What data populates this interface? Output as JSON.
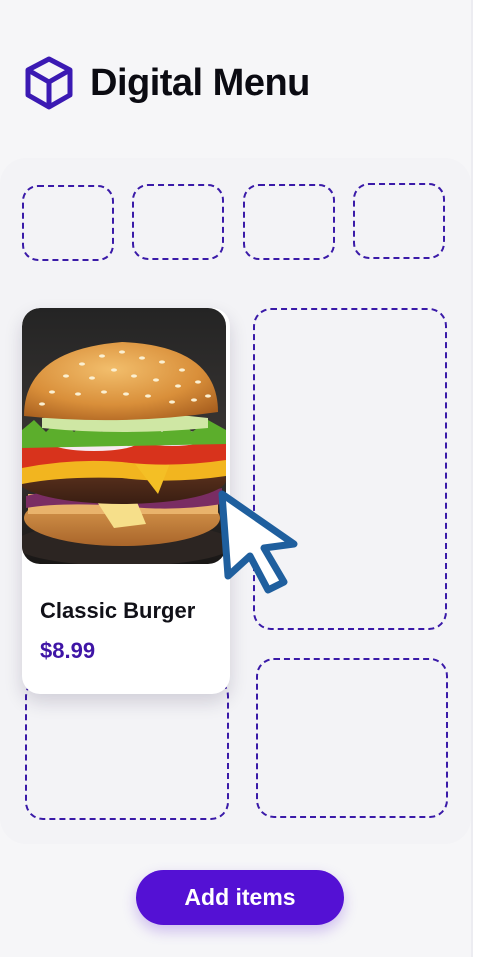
{
  "app": {
    "title": "Digital Menu",
    "logo_icon": "cube-icon",
    "brand_color": "#4b1cc0"
  },
  "menu_board": {
    "empty_slot_count": 7,
    "items": [
      {
        "name": "Classic Burger",
        "price": "$8.99",
        "image": "burger-photo"
      }
    ]
  },
  "cursor": {
    "icon": "pointer-arrow-icon"
  },
  "actions": {
    "add_items_label": "Add items",
    "accent": "#5411d4"
  }
}
